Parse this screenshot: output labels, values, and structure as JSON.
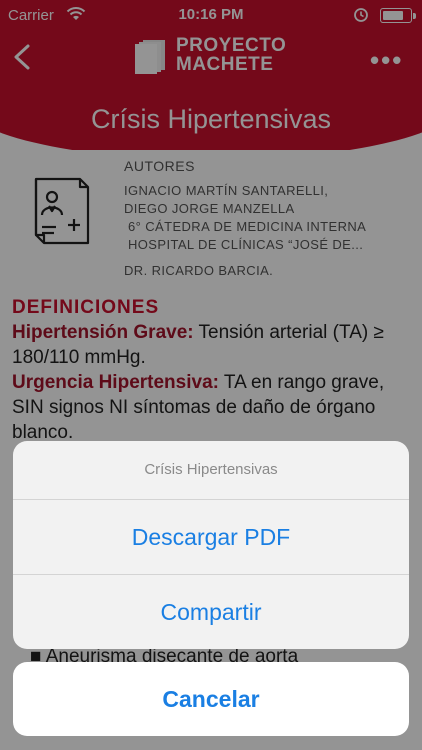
{
  "status_bar": {
    "carrier": "Carrier",
    "time": "10:16 PM"
  },
  "header": {
    "logo_line1": "PROYECTO",
    "logo_line2": "MACHETE",
    "title": "Crísis Hipertensivas",
    "more_label": "•••"
  },
  "authors": {
    "label": "AUTORES",
    "lines": [
      "IGNACIO MARTÍN SANTARELLI,",
      "DIEGO JORGE MANZELLA",
      "6° CÁTEDRA DE MEDICINA INTERNA",
      "HOSPITAL DE CLÍNICAS “JOSÉ DE...",
      "DR. RICARDO BARCIA."
    ]
  },
  "content": {
    "heading": "DEFINICIONES",
    "term1": "Hipertensión Grave:",
    "text1": " Tensión arterial (TA) ≥ 180/110 mmHg.",
    "term2": "Urgencia Hipertensiva:",
    "text2": " TA en rango grave, SIN signos NI síntomas de daño de órgano blanco.",
    "bullet": "Aneurisma disecante de aorta"
  },
  "action_sheet": {
    "title": "Crísis Hipertensivas",
    "download_label": "Descargar PDF",
    "share_label": "Compartir",
    "cancel_label": "Cancelar"
  },
  "colors": {
    "brand_red": "#c8102e",
    "term": "#a3142b",
    "action_blue": "#1a7fe3"
  }
}
